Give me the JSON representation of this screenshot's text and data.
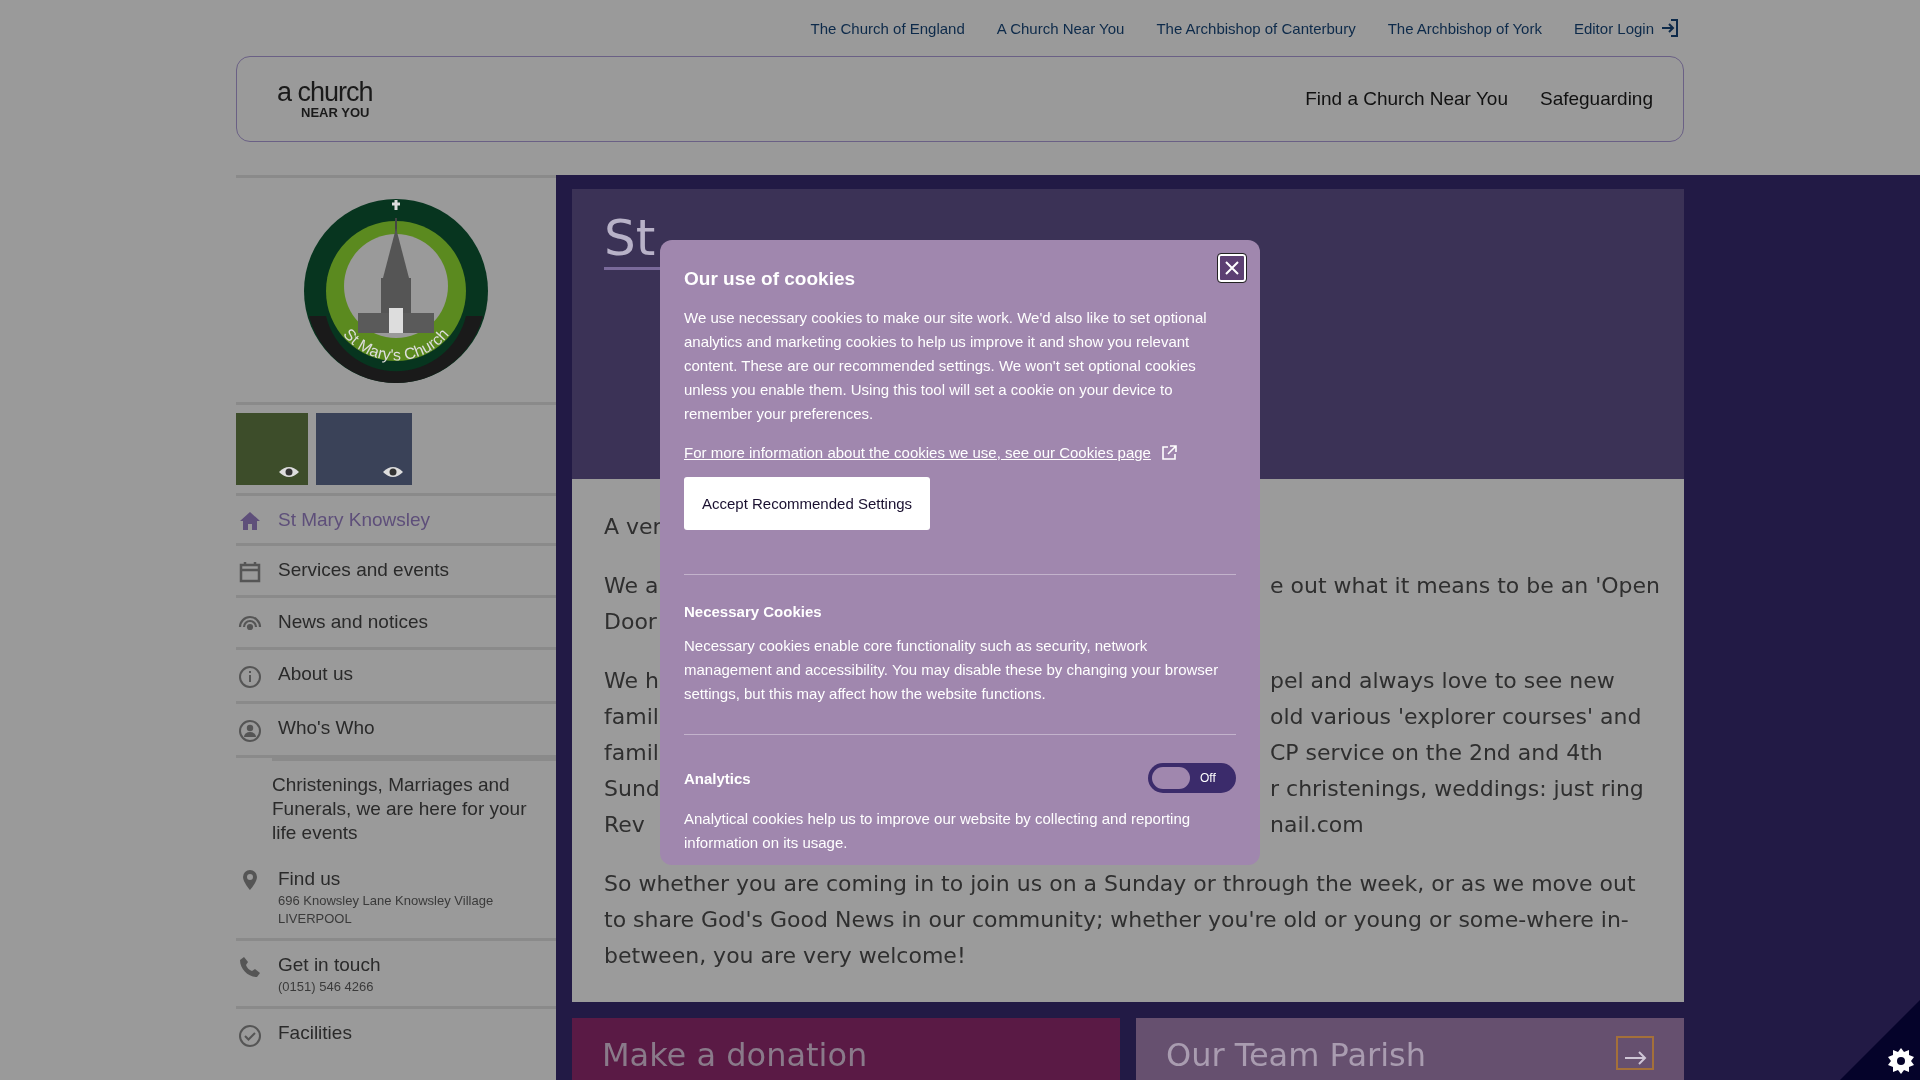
{
  "top_links": [
    {
      "label": "The Church of England"
    },
    {
      "label": "A Church Near You"
    },
    {
      "label": "The Archbishop of Canterbury"
    },
    {
      "label": "The Archbishop of York"
    }
  ],
  "editor_login": {
    "label": "Editor Login"
  },
  "logo": {
    "line1": "a church",
    "line2": "NEAR YOU"
  },
  "nav": [
    {
      "label": "Find a Church Near You"
    },
    {
      "label": "Safeguarding"
    }
  ],
  "sidebar": {
    "emblem_text": "St Mary's Church",
    "items": [
      {
        "kind": "link",
        "label": "St Mary Knowsley",
        "selected": true
      },
      {
        "kind": "link",
        "label": "Services and events",
        "selected": false
      },
      {
        "kind": "link",
        "label": "News and notices",
        "selected": false
      },
      {
        "kind": "link",
        "label": "About us",
        "selected": false
      },
      {
        "kind": "link",
        "label": "Who's Who",
        "selected": false
      },
      {
        "kind": "promo",
        "label": "Christenings, Marriages and Funerals, we are here for your life events",
        "selected": false
      },
      {
        "kind": "link",
        "label": "Find us",
        "details": [
          "696 Knowsley Lane Knowsley Village",
          "LIVERPOOL"
        ],
        "selected": false
      },
      {
        "kind": "link",
        "label": "Get in touch",
        "details": [
          "(0151) 546 4266"
        ],
        "selected": false
      },
      {
        "kind": "link",
        "label": "Facilities",
        "selected": false
      }
    ]
  },
  "hero": {
    "title": "St"
  },
  "content": {
    "paragraphs": [
      [
        {
          "left": "A ver"
        }
      ],
      [
        {
          "left": "We a",
          "right": "e out what it means to be an 'Open"
        },
        {
          "left": "Door"
        }
      ],
      [
        {
          "left": "We h",
          "right": "pel and always love to see new"
        },
        {
          "left": "famil",
          "right": "old various 'explorer courses' and"
        },
        {
          "left": "famil",
          "right": "CP service on the 2nd and 4th"
        },
        {
          "left": "Sund",
          "right": "r christenings, weddings: just ring"
        },
        {
          "left": "Rev",
          "right": "nail.com"
        }
      ]
    ],
    "paragraph": "So whether you are coming in to join us on a Sunday or through the week, or as we move out to share God's Good News in our community; whether you're old or young or some-where in-between, you are very welcome!"
  },
  "cards": [
    {
      "kind": "donation",
      "title": "Make a donation"
    },
    {
      "kind": "parish",
      "title": "Our Team Parish"
    }
  ],
  "cookies": {
    "title": "Our use of cookies",
    "intro": "We use necessary cookies to make our site work. We'd also like to set optional analytics and marketing cookies to help us improve it and show you relevant content. These are our recommended settings. We won't set optional cookies unless you enable them. Using this tool will set a cookie on your device to remember your preferences.",
    "link": "For more information about the cookies we use, see our Cookies page",
    "button": "Accept Recommended Settings",
    "sections": [
      {
        "title": "Necessary Cookies",
        "text": "Necessary cookies enable core functionality such as security, network management and accessibility. You may disable these by changing your browser settings, but this may affect how the website functions."
      },
      {
        "title": "Analytics",
        "toggle": {
          "on": false,
          "label": "Off"
        },
        "text": "Analytical cookies help us to improve our website by collecting and reporting information on its usage."
      }
    ]
  }
}
